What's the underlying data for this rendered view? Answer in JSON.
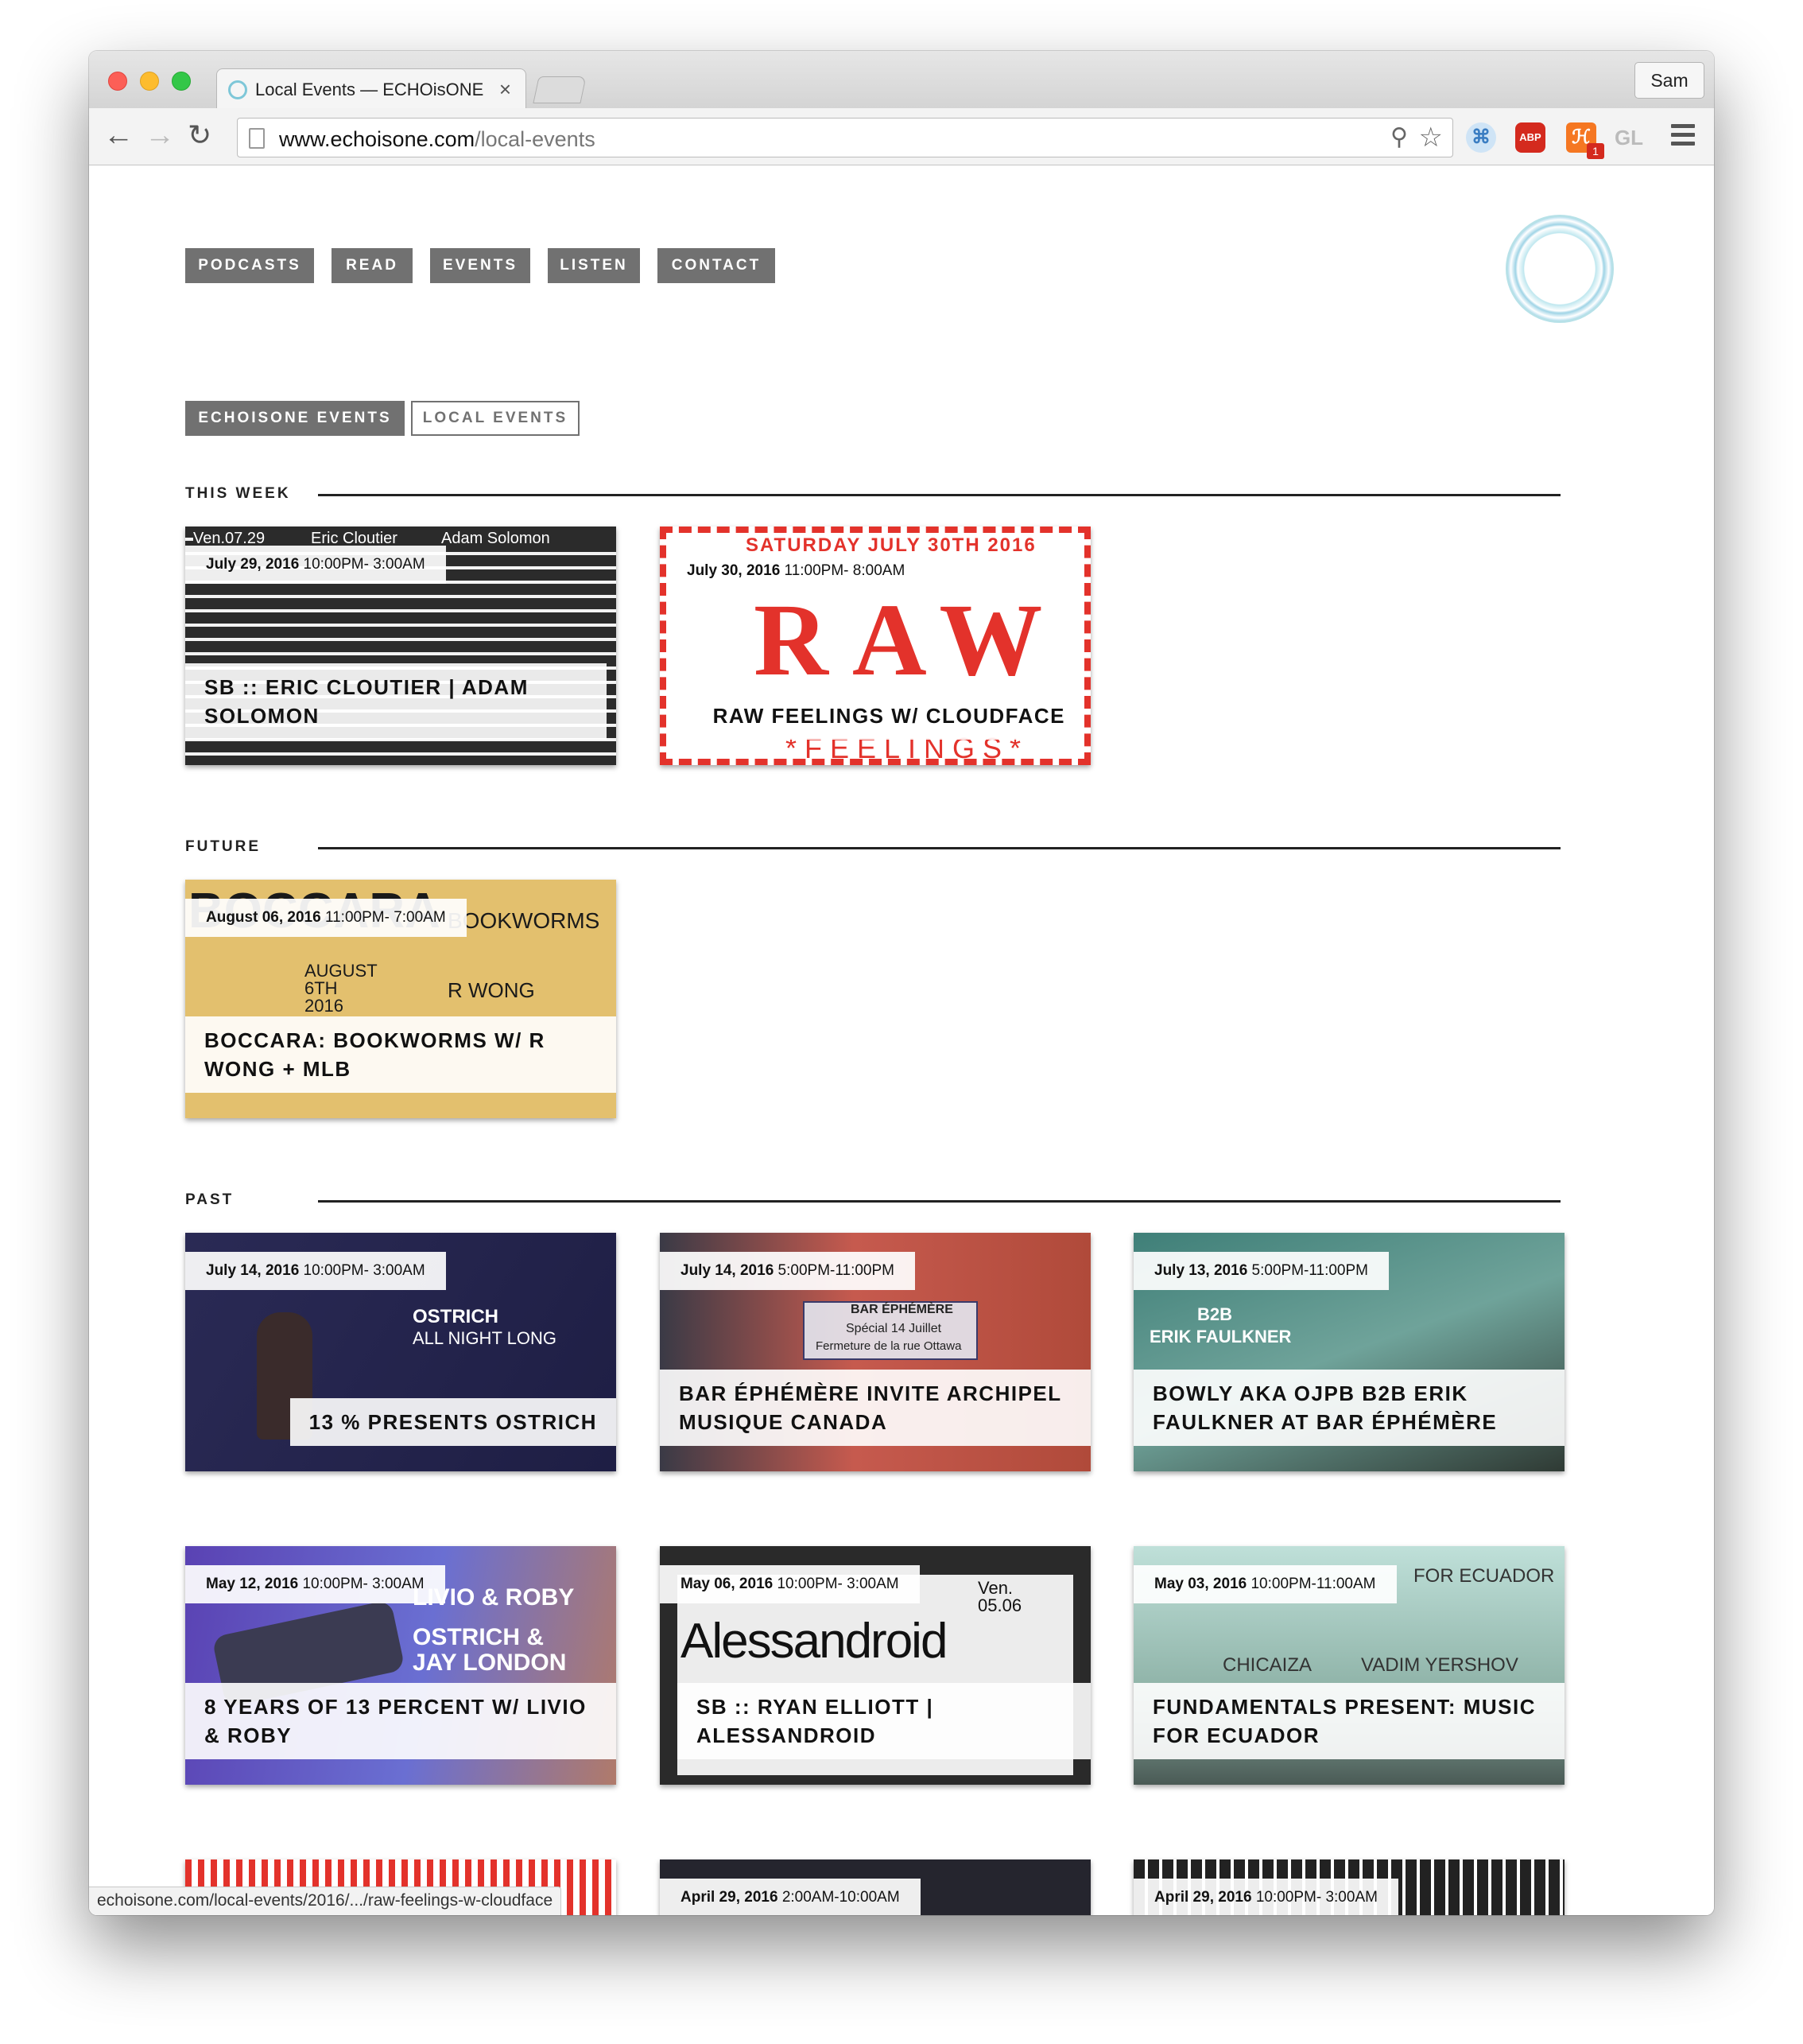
{
  "browser": {
    "tab_title": "Local Events — ECHOisONE",
    "tab_close": "×",
    "profile": "Sam",
    "url_domain": "www.echoisone.com",
    "url_path": "/local-events",
    "extensions": {
      "cmd": "⌘",
      "abp": "ABP",
      "hub": "ℋ",
      "hub_badge": "1",
      "gl": "GL"
    },
    "status_url": "echoisone.com/local-events/2016/.../raw-feelings-w-cloudface"
  },
  "nav": [
    "PODCASTS",
    "READ",
    "EVENTS",
    "LISTEN",
    "CONTACT"
  ],
  "filters": {
    "echoisone": "ECHOISONE EVENTS",
    "local": "LOCAL EVENTS"
  },
  "sections": {
    "this_week": "THIS WEEK",
    "future": "FUTURE",
    "past": "PAST"
  },
  "events": [
    {
      "date": "July 29, 2016",
      "time": "10:00PM- 3:00AM",
      "title": "SB :: ERIC CLOUTIER | ADAM SOLOMON",
      "art": [
        "Ven.07.29",
        "Eric Cloutier",
        "Adam Solomon"
      ]
    },
    {
      "date": "July 30, 2016",
      "time": "11:00PM- 8:00AM",
      "title": "RAW FEELINGS W/ CLOUDFACE",
      "art": [
        "SATURDAY JULY 30TH 2016",
        "RAW",
        "*FEELINGS*"
      ]
    },
    {
      "date": "August 06, 2016",
      "time": "11:00PM- 7:00AM",
      "title": "BOCCARA: BOOKWORMS W/ R WONG + MLB",
      "art": [
        "BOCCARA",
        "AUGUST 6TH 2016",
        "BOOKWORMS",
        "R WONG"
      ]
    },
    {
      "date": "July 14, 2016",
      "time": "10:00PM- 3:00AM",
      "title": "13 % PRESENTS OSTRICH",
      "art": [
        "OSTRICH",
        "ALL NIGHT LONG"
      ]
    },
    {
      "date": "July 14, 2016",
      "time": "5:00PM-11:00PM",
      "title": "BAR ÉPHÉMÈRE INVITE ARCHIPEL MUSIQUE CANADA",
      "art": [
        "BAR ÉPHÉMÈRE",
        "Spécial 14 Juillet",
        "Fermeture de la rue Ottawa"
      ]
    },
    {
      "date": "July 13, 2016",
      "time": "5:00PM-11:00PM",
      "title": "BOWLY AKA OJPB B2B ERIK FAULKNER AT BAR ÉPHÉMÈRE",
      "art": [
        "B2B",
        "ERIK FAULKNER"
      ]
    },
    {
      "date": "May 12, 2016",
      "time": "10:00PM- 3:00AM",
      "title": "8 YEARS OF 13 PERCENT W/ LIVIO & ROBY",
      "art": [
        "LIVIO & ROBY",
        "OSTRICH &",
        "JAY LONDON"
      ]
    },
    {
      "date": "May 06, 2016",
      "time": "10:00PM- 3:00AM",
      "title": "SB :: RYAN ELLIOTT | ALESSANDROID",
      "art": [
        "Alessandroid",
        "Ven. 05.06"
      ]
    },
    {
      "date": "May 03, 2016",
      "time": "10:00PM-11:00AM",
      "title": "FUNDAMENTALS PRESENT: MUSIC FOR ECUADOR",
      "art": [
        "FOR ECUADOR",
        "CHICAIZA",
        "VADIM YERSHOV"
      ]
    },
    {
      "date": "",
      "time": "",
      "title": "",
      "art": []
    },
    {
      "date": "April 29, 2016",
      "time": "2:00AM-10:00AM",
      "title": "",
      "art": []
    },
    {
      "date": "April 29, 2016",
      "time": "10:00PM- 3:00AM",
      "title": "",
      "art": []
    }
  ]
}
